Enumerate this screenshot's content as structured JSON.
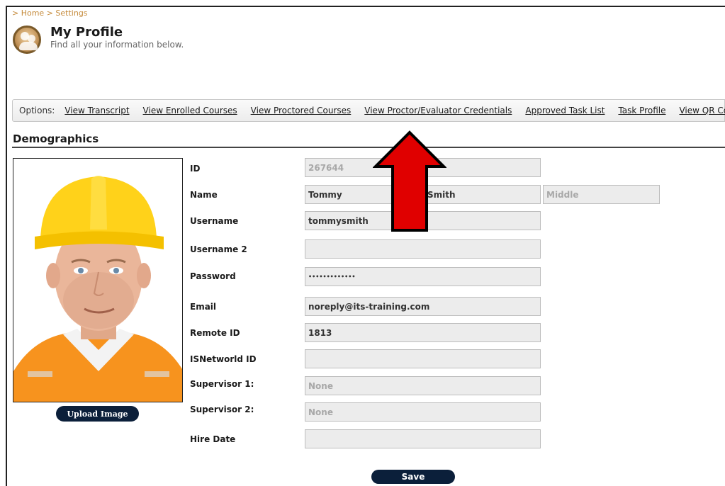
{
  "breadcrumb": {
    "prefix": ">",
    "home": "Home",
    "sep": ">",
    "current": "Settings"
  },
  "header": {
    "title": "My Profile",
    "subtitle": "Find all your information below."
  },
  "options": {
    "label": "Options:",
    "links": [
      "View Transcript",
      "View Enrolled Courses",
      "View Proctored Courses",
      "View Proctor/Evaluator Credentials",
      "Approved Task List",
      "Task Profile",
      "View QR Code"
    ]
  },
  "section": {
    "title": "Demographics"
  },
  "photo": {
    "upload_label": "Upload Image"
  },
  "fields": {
    "id": {
      "label": "ID",
      "value": "267644"
    },
    "name": {
      "label": "Name",
      "first": "Tommy",
      "last": "Smith",
      "middle_placeholder": "Middle"
    },
    "username": {
      "label": "Username",
      "value": "tommysmith"
    },
    "username2": {
      "label": "Username 2",
      "value": ""
    },
    "password": {
      "label": "Password",
      "value": "•••••••••••••"
    },
    "email": {
      "label": "Email",
      "value": "noreply@its-training.com"
    },
    "remote_id": {
      "label": "Remote ID",
      "value": "1813"
    },
    "isnetworld_id": {
      "label": "ISNetworld ID",
      "value": ""
    },
    "supervisor1": {
      "label": "Supervisor 1:",
      "value": "None"
    },
    "supervisor2": {
      "label": "Supervisor 2:",
      "value": "None"
    },
    "hire_date": {
      "label": "Hire Date",
      "value": ""
    }
  },
  "actions": {
    "save_label": "Save"
  },
  "colors": {
    "button_bg": "#0b1f3a",
    "arrow": "#e00000",
    "breadcrumb": "#c58a3a"
  }
}
